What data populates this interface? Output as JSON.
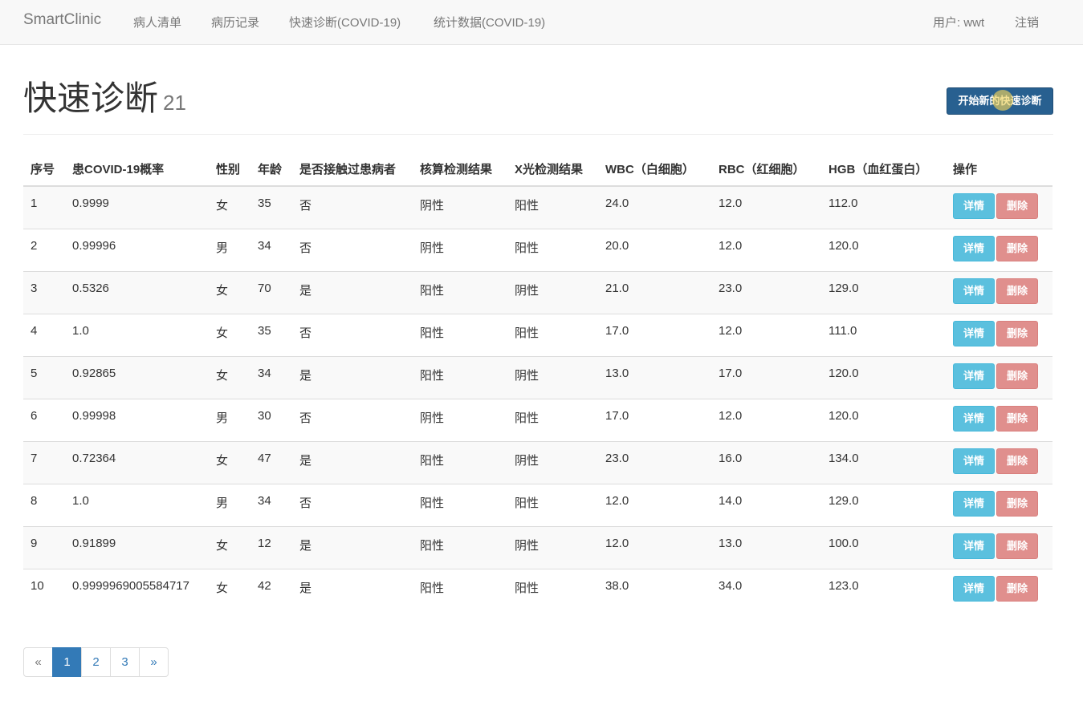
{
  "nav": {
    "brand": "SmartClinic",
    "links": [
      "病人清单",
      "病历记录",
      "快速诊断(COVID-19)",
      "统计数据(COVID-19)"
    ],
    "user": "用户: wwt",
    "logout": "注销"
  },
  "header": {
    "title": "快速诊断",
    "count": "21",
    "new_button": "开始新的快速诊断"
  },
  "table": {
    "columns": [
      "序号",
      "患COVID-19概率",
      "性别",
      "年龄",
      "是否接触过患病者",
      "核算检测结果",
      "X光检测结果",
      "WBC（白细胞）",
      "RBC（红细胞）",
      "HGB（血红蛋白）",
      "操作"
    ],
    "detail_label": "详情",
    "delete_label": "删除",
    "rows": [
      [
        "1",
        "0.9999",
        "女",
        "35",
        "否",
        "阴性",
        "阳性",
        "24.0",
        "12.0",
        "112.0"
      ],
      [
        "2",
        "0.99996",
        "男",
        "34",
        "否",
        "阴性",
        "阳性",
        "20.0",
        "12.0",
        "120.0"
      ],
      [
        "3",
        "0.5326",
        "女",
        "70",
        "是",
        "阳性",
        "阴性",
        "21.0",
        "23.0",
        "129.0"
      ],
      [
        "4",
        "1.0",
        "女",
        "35",
        "否",
        "阳性",
        "阳性",
        "17.0",
        "12.0",
        "111.0"
      ],
      [
        "5",
        "0.92865",
        "女",
        "34",
        "是",
        "阳性",
        "阴性",
        "13.0",
        "17.0",
        "120.0"
      ],
      [
        "6",
        "0.99998",
        "男",
        "30",
        "否",
        "阴性",
        "阳性",
        "17.0",
        "12.0",
        "120.0"
      ],
      [
        "7",
        "0.72364",
        "女",
        "47",
        "是",
        "阳性",
        "阴性",
        "23.0",
        "16.0",
        "134.0"
      ],
      [
        "8",
        "1.0",
        "男",
        "34",
        "否",
        "阳性",
        "阳性",
        "12.0",
        "14.0",
        "129.0"
      ],
      [
        "9",
        "0.91899",
        "女",
        "12",
        "是",
        "阳性",
        "阴性",
        "12.0",
        "13.0",
        "100.0"
      ],
      [
        "10",
        "0.9999969005584717",
        "女",
        "42",
        "是",
        "阳性",
        "阳性",
        "38.0",
        "34.0",
        "123.0"
      ]
    ]
  },
  "pagination": {
    "prev": "«",
    "pages": [
      "1",
      "2",
      "3"
    ],
    "active_page": "1",
    "next": "»"
  },
  "colors": {
    "primary": "#337ab7",
    "primary_dark": "#286090",
    "info": "#5bc0de",
    "danger": "#e08f8d"
  }
}
